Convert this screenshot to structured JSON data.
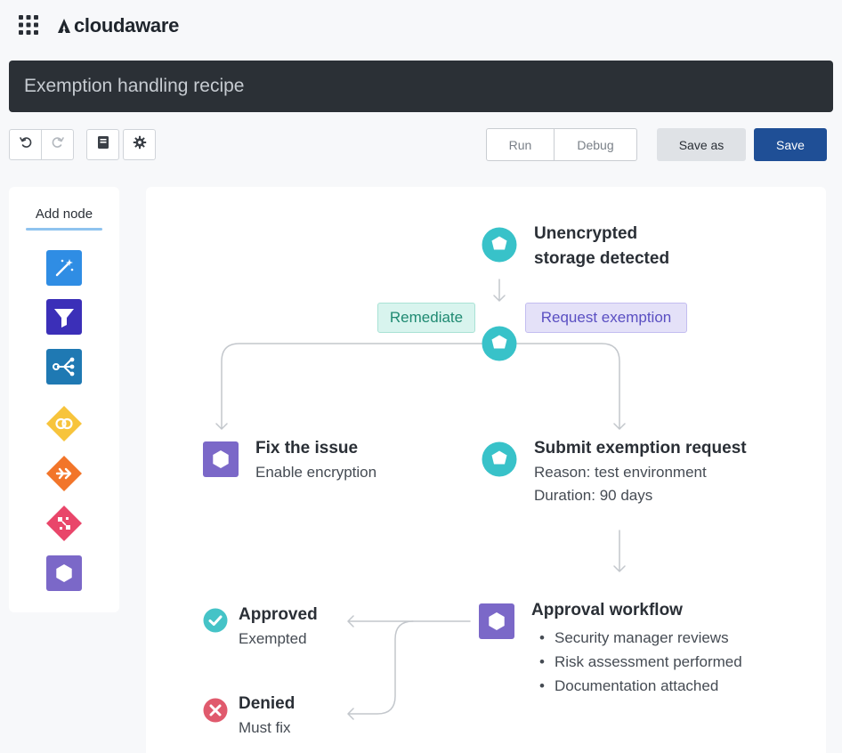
{
  "app": {
    "brand": "cloudaware",
    "icons": {
      "apps": "apps-grid-icon",
      "logo": "cloudaware-logo-icon"
    }
  },
  "recipe": {
    "title": "Exemption handling recipe"
  },
  "toolbar": {
    "undo_icon": "undo-icon",
    "redo_icon": "redo-icon",
    "docs_icon": "book-icon",
    "settings_icon": "gear-icon",
    "run_label": "Run",
    "debug_label": "Debug",
    "save_as_label": "Save as",
    "save_label": "Save"
  },
  "palette": {
    "title": "Add node",
    "items": [
      {
        "icon": "magic-wand-icon",
        "color": "#2f8de4"
      },
      {
        "icon": "filter-icon",
        "color": "#3b2fb8"
      },
      {
        "icon": "branch-icon",
        "color": "#1f79b3"
      },
      {
        "icon": "link-rings-icon",
        "color": "#f7c43c"
      },
      {
        "icon": "merge-arrows-icon",
        "color": "#f2752a"
      },
      {
        "icon": "shuffle-icon",
        "color": "#e9466a"
      },
      {
        "icon": "hexagon-icon",
        "color": "#7b68c8"
      }
    ]
  },
  "flow": {
    "colors": {
      "teal": "#38c2c9",
      "purple": "#7b68c8",
      "approved": "#45c3c7",
      "denied": "#e05a6d"
    },
    "trigger": {
      "title_line1": "Unencrypted",
      "title_line2": "storage detected"
    },
    "branches": {
      "left": "Remediate",
      "right": "Request exemption"
    },
    "fix": {
      "title": "Fix the issue",
      "detail": "Enable encryption"
    },
    "submit": {
      "title": "Submit exemption request",
      "reason": "Reason: test environment",
      "duration": "Duration: 90 days"
    },
    "approval": {
      "title": "Approval workflow",
      "steps": [
        "Security manager reviews",
        "Risk assessment performed",
        "Documentation attached"
      ]
    },
    "approved": {
      "title": "Approved",
      "detail": "Exempted"
    },
    "denied": {
      "title": "Denied",
      "detail": "Must fix"
    }
  }
}
